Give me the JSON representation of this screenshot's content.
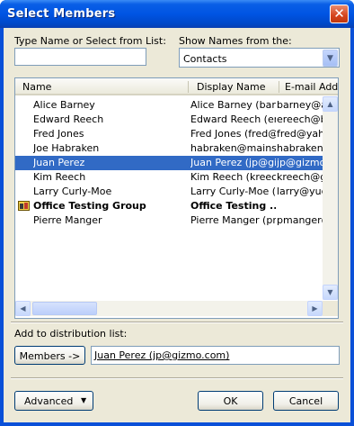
{
  "window": {
    "title": "Select Members",
    "close_glyph": "✕"
  },
  "search": {
    "label": "Type Name or Select from List:",
    "value": ""
  },
  "address_book": {
    "label": "Show Names from the:",
    "selected": "Contacts"
  },
  "columns": [
    "Name",
    "Display Name",
    "E-mail Address"
  ],
  "rows": [
    {
      "name": "Alice Barney",
      "display": "Alice Barney (barney@...",
      "email": "barney@al..."
    },
    {
      "name": "Edward Reech",
      "display": "Edward Reech (ereech@...",
      "email": "ereech@bo..."
    },
    {
      "name": "Fred Jones",
      "display": "Fred Jones (fred@yaho...",
      "email": "fred@yahoo..."
    },
    {
      "name": "Joe Habraken",
      "display": "habraken@mainst...",
      "email": "habraken@..."
    },
    {
      "name": "Juan Perez",
      "display": "Juan Perez (jp@gizmo...",
      "email": "jp@gizmo..."
    },
    {
      "name": "Kim Reech",
      "display": "Kim Reech (kreech@...",
      "email": "kreech@gi..."
    },
    {
      "name": "Larry Curly-Moe",
      "display": "Larry Curly-Moe (lar...",
      "email": "larry@yuck..."
    },
    {
      "name": "Office Testing Group",
      "display": "Office Testing ...",
      "email": ""
    },
    {
      "name": "Pierre Manger",
      "display": "Pierre Manger (pm...",
      "email": "pmanger@..."
    }
  ],
  "selected_row": "Juan Perez",
  "group_row": "Office Testing Group",
  "distribution": {
    "label": "Add to distribution list:",
    "button": "Members ->",
    "value": "Juan Perez (jp@gizmo.com)"
  },
  "buttons": {
    "advanced": "Advanced",
    "ok": "OK",
    "cancel": "Cancel"
  },
  "icons": [
    "close-icon",
    "dropdown-arrow-icon",
    "group-icon",
    "scroll-up-icon",
    "scroll-down-icon",
    "scroll-left-icon",
    "scroll-right-icon"
  ],
  "colors": {
    "title_bar": "#0054e3",
    "selection": "#316ac5",
    "dialog_bg": "#ece9d8",
    "close_button": "#d5441c"
  }
}
